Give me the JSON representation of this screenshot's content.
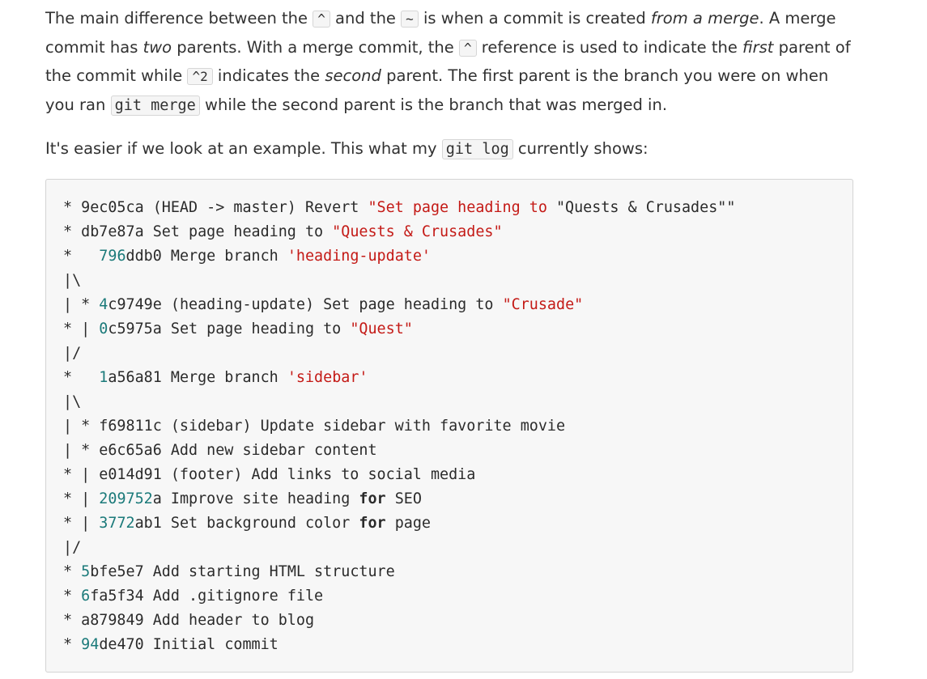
{
  "paragraph1": {
    "p1": "The main difference between the ",
    "caret": "^",
    "p2": " and the ",
    "tilde": "~",
    "p3": " is when a commit is created ",
    "em_from_merge": "from a merge",
    "p4": ". A merge commit has ",
    "em_two": "two",
    "p5": " parents. With a merge commit, the ",
    "caret2": "^",
    "p6": " reference is used to indicate the ",
    "em_first": "first",
    "p7": " parent of the commit while ",
    "caret_2": "^2",
    "p8": " indicates the ",
    "em_second": "second",
    "p9": " parent. The first parent is the branch you were on when you ran ",
    "git_merge": "git merge",
    "p10": " while the second parent is the branch that was merged in."
  },
  "paragraph2": {
    "p1": "It's easier if we look at an example. This what my ",
    "git_log": "git log",
    "p2": " currently shows:"
  },
  "log_lines": [
    [
      {
        "t": "* 9ec05ca (HEAD -> master) Revert ",
        "c": "plain"
      },
      {
        "t": "\"Set page heading to ",
        "c": "str"
      },
      {
        "t": "\"Quests & Crusades\"\"",
        "c": "plain"
      }
    ],
    [
      {
        "t": "* db7e87a Set page heading to ",
        "c": "plain"
      },
      {
        "t": "\"Quests & Crusades\"",
        "c": "str"
      }
    ],
    [
      {
        "t": "*   ",
        "c": "plain"
      },
      {
        "t": "796",
        "c": "num"
      },
      {
        "t": "ddb0 Merge branch ",
        "c": "plain"
      },
      {
        "t": "'heading-update'",
        "c": "str"
      }
    ],
    [
      {
        "t": "|\\",
        "c": "plain"
      }
    ],
    [
      {
        "t": "| * ",
        "c": "plain"
      },
      {
        "t": "4",
        "c": "num"
      },
      {
        "t": "c9749e (heading-update) Set page heading to ",
        "c": "plain"
      },
      {
        "t": "\"Crusade\"",
        "c": "str"
      }
    ],
    [
      {
        "t": "* | ",
        "c": "plain"
      },
      {
        "t": "0",
        "c": "num"
      },
      {
        "t": "c5975a Set page heading to ",
        "c": "plain"
      },
      {
        "t": "\"Quest\"",
        "c": "str"
      }
    ],
    [
      {
        "t": "|/",
        "c": "plain"
      }
    ],
    [
      {
        "t": "*   ",
        "c": "plain"
      },
      {
        "t": "1",
        "c": "num"
      },
      {
        "t": "a56a81 Merge branch ",
        "c": "plain"
      },
      {
        "t": "'sidebar'",
        "c": "str"
      }
    ],
    [
      {
        "t": "|\\",
        "c": "plain"
      }
    ],
    [
      {
        "t": "| * f69811c (sidebar) Update sidebar ",
        "c": "plain"
      },
      {
        "t": "with",
        "c": "plain"
      },
      {
        "t": " favorite movie",
        "c": "plain"
      }
    ],
    [
      {
        "t": "| * e6c65a6 Add new sidebar content",
        "c": "plain"
      }
    ],
    [
      {
        "t": "* | e014d91 (footer) Add links to social media",
        "c": "plain"
      }
    ],
    [
      {
        "t": "* | ",
        "c": "plain"
      },
      {
        "t": "209752",
        "c": "num"
      },
      {
        "t": "a Improve site heading ",
        "c": "plain"
      },
      {
        "t": "for",
        "c": "kw"
      },
      {
        "t": " SEO",
        "c": "plain"
      }
    ],
    [
      {
        "t": "* | ",
        "c": "plain"
      },
      {
        "t": "3772",
        "c": "num"
      },
      {
        "t": "ab1 Set background color ",
        "c": "plain"
      },
      {
        "t": "for",
        "c": "kw"
      },
      {
        "t": " page",
        "c": "plain"
      }
    ],
    [
      {
        "t": "|/",
        "c": "plain"
      }
    ],
    [
      {
        "t": "* ",
        "c": "plain"
      },
      {
        "t": "5",
        "c": "num"
      },
      {
        "t": "bfe5e7 Add starting HTML structure",
        "c": "plain"
      }
    ],
    [
      {
        "t": "* ",
        "c": "plain"
      },
      {
        "t": "6",
        "c": "num"
      },
      {
        "t": "fa5f34 Add .gitignore file",
        "c": "plain"
      }
    ],
    [
      {
        "t": "* a879849 Add header to blog",
        "c": "plain"
      }
    ],
    [
      {
        "t": "* ",
        "c": "plain"
      },
      {
        "t": "94",
        "c": "num"
      },
      {
        "t": "de470 Initial commit",
        "c": "plain"
      }
    ]
  ],
  "colors": {
    "string": "#c41a16",
    "number": "#1b7a7a",
    "text": "#313131",
    "code_bg": "#f7f7f7"
  }
}
